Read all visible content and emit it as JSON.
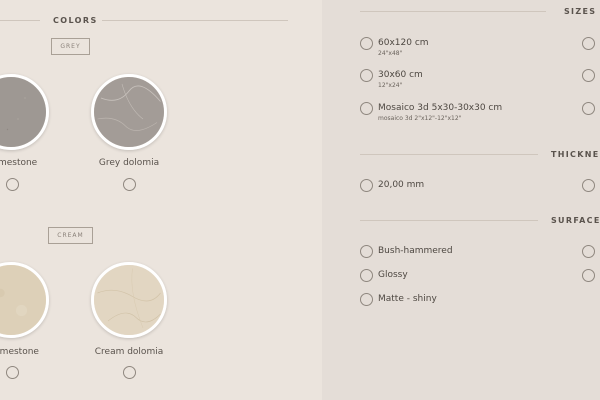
{
  "colors": {
    "title": "COLORS",
    "groups": [
      {
        "label": "GREY",
        "items": [
          {
            "name": "Grey limestone",
            "visible_label": "y limestone"
          },
          {
            "name": "Grey dolomia",
            "visible_label": "Grey dolomia"
          }
        ]
      },
      {
        "label": "CREAM",
        "items": [
          {
            "name": "Cream limestone",
            "visible_label": "m limestone"
          },
          {
            "name": "Cream dolomia",
            "visible_label": "Cream dolomia"
          }
        ]
      }
    ]
  },
  "sizes": {
    "title": "SIZES",
    "options": [
      {
        "label": "60x120 cm",
        "sub": "24\"x48\""
      },
      {
        "label": "30x60 cm",
        "sub": "12\"x24\""
      },
      {
        "label": "Mosaico 3d 5x30-30x30 cm",
        "sub": "mosaico 3d 2\"x12\"-12\"x12\""
      }
    ]
  },
  "thickness": {
    "title": "THICKNESS",
    "options": [
      {
        "label": "20,00 mm"
      }
    ]
  },
  "surfaces": {
    "title": "SURFACES*",
    "options": [
      {
        "label": "Bush-hammered"
      },
      {
        "label": "Glossy"
      },
      {
        "label": "Matte - shiny"
      }
    ]
  },
  "palette": {
    "left_bg": "#ebe4dd",
    "right_bg": "#e4ddd7",
    "grey_limestone": "#9e9893",
    "grey_dolomia": "#a39c97",
    "cream_limestone": "#ddd0b8",
    "cream_dolomia": "#e2d6c2"
  }
}
